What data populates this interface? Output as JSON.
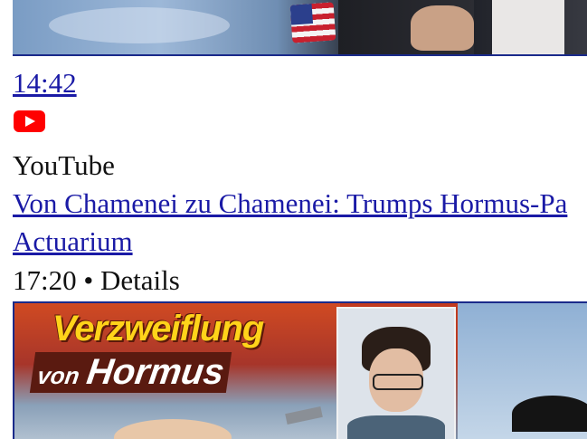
{
  "top_video": {
    "thumbnail_icon": "video-thumbnail",
    "duration": "14:42"
  },
  "source_icon": "youtube-icon",
  "colors": {
    "link": "#1a1aa6",
    "youtube_red": "#ff0000",
    "thumb_border": "#1a2a8a"
  },
  "result": {
    "source": "YouTube",
    "title": "Von Chamenei zu Chamenei: Trumps Hormus-Pa",
    "channel": "Actuarium",
    "meta": "17:20 • Details"
  },
  "bottom_video": {
    "caption_line1": "Verzweiflung",
    "caption_small": "von",
    "caption_big": "Hormus"
  }
}
